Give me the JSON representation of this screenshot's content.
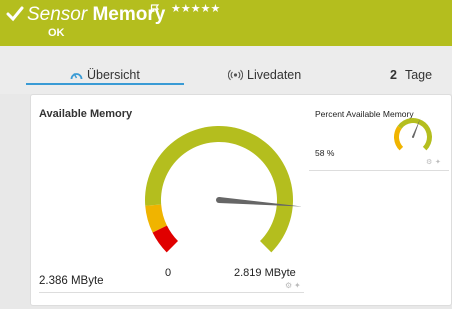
{
  "header": {
    "kind": "Sensor",
    "name": "Memory",
    "stars": "★★★★★",
    "status": "OK",
    "color": "#b4be1e"
  },
  "tabs": [
    {
      "label": "Übersicht",
      "icon": "gauge-icon",
      "active": true
    },
    {
      "label": "Livedaten",
      "icon": "live-signal-icon"
    },
    {
      "number": "2",
      "label": "Tage"
    }
  ],
  "main_gauge": {
    "title": "Available Memory",
    "value_text": "2.386 MByte",
    "min_label": "0",
    "max_label": "2.819 MByte",
    "value_fraction": 0.85,
    "colors": {
      "ok": "#b4be1e",
      "warning": "#f0b400",
      "error": "#e00000",
      "needle": "#666666"
    }
  },
  "mini_gauge": {
    "title": "Percent Available Memory",
    "value_text": "58 %",
    "value_fraction": 0.58
  }
}
